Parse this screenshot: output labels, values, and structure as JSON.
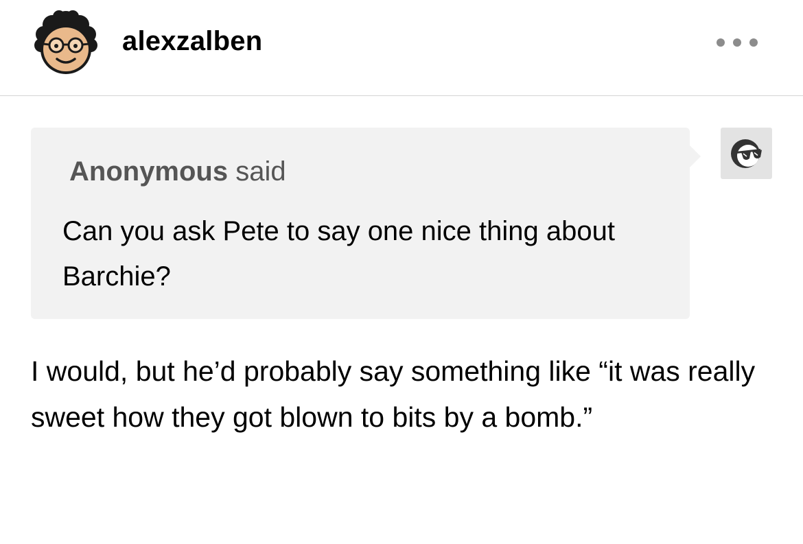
{
  "post": {
    "username": "alexzalben",
    "avatar_icon": "curly-hair-glasses-avatar-icon",
    "more_icon": "more-options-ellipsis-icon"
  },
  "ask": {
    "asker": "Anonymous",
    "said": "said",
    "question": "Can you ask Pete to say one nice thing about Barchie?",
    "asker_avatar_icon": "anonymous-sunglasses-avatar-icon",
    "bubble_color": "#f2f2f2"
  },
  "answer": {
    "text": "I would, but he’d probably say something like “it was really sweet how they got blown to bits by a bomb.”"
  },
  "colors": {
    "divider": "#d4d4d4",
    "ellipsis": "#8c8c8c",
    "asker_text": "#555555"
  }
}
